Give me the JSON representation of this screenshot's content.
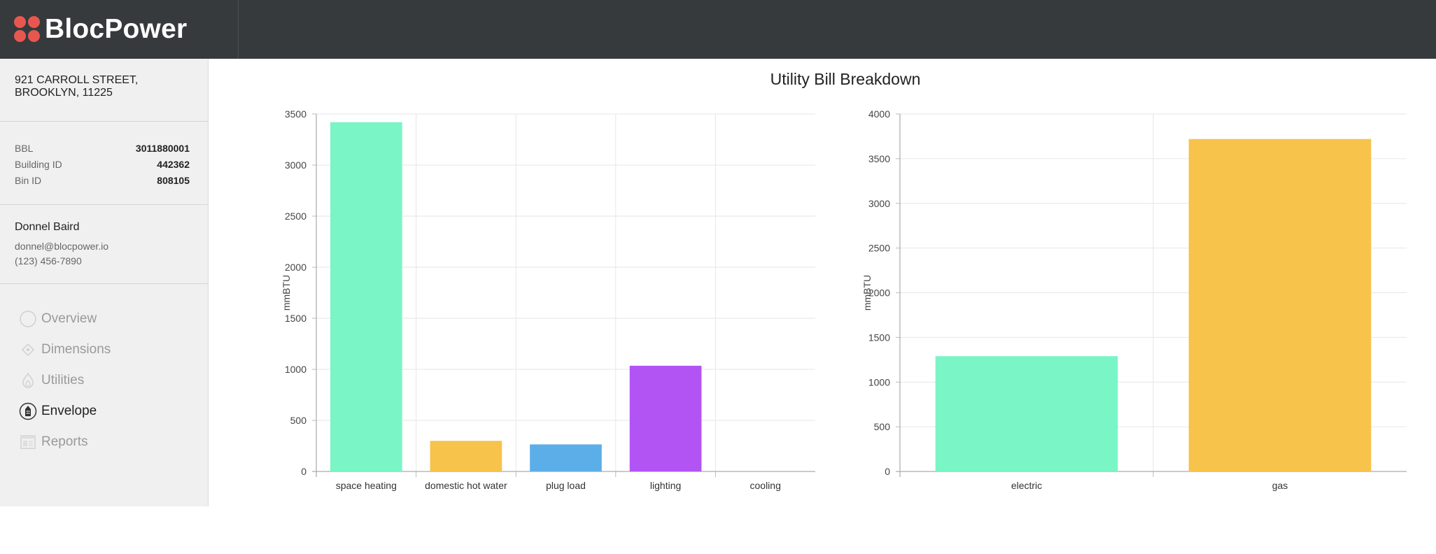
{
  "header": {
    "logo_text": "BlocPower",
    "logo_color": "#e8574f",
    "bar_color": "#363a3d"
  },
  "sidebar": {
    "address_line1": "921 CARROLL STREET,",
    "address_line2": "BROOKLYN, 11225",
    "ids": [
      {
        "label": "BBL",
        "value": "3011880001"
      },
      {
        "label": "Building ID",
        "value": "442362"
      },
      {
        "label": "Bin ID",
        "value": "808105"
      }
    ],
    "contact": {
      "name": "Donnel Baird",
      "email": "donnel@blocpower.io",
      "phone": "(123) 456-7890"
    },
    "nav": [
      {
        "label": "Overview",
        "icon": "circle-icon",
        "active": false
      },
      {
        "label": "Dimensions",
        "icon": "diamond-icon",
        "active": false
      },
      {
        "label": "Utilities",
        "icon": "flame-icon",
        "active": false
      },
      {
        "label": "Envelope",
        "icon": "building-icon",
        "active": true
      },
      {
        "label": "Reports",
        "icon": "report-icon",
        "active": false
      }
    ]
  },
  "main": {
    "title": "Utility Bill Breakdown"
  },
  "chart_data": [
    {
      "type": "bar",
      "categories": [
        "space heating",
        "domestic hot water",
        "plug load",
        "lighting",
        "cooling"
      ],
      "values": [
        3420,
        300,
        265,
        1035,
        0
      ],
      "colors": [
        "#79f5c6",
        "#f7c34b",
        "#5caee8",
        "#b254f4",
        "#cccccc"
      ],
      "ylabel": "mmBTU",
      "xlabel": "",
      "ylim": [
        0,
        3500
      ],
      "yticks": [
        0,
        500,
        1000,
        1500,
        2000,
        2500,
        3000,
        3500
      ],
      "grid": true
    },
    {
      "type": "bar",
      "categories": [
        "electric",
        "gas"
      ],
      "values": [
        1290,
        3720
      ],
      "colors": [
        "#79f5c6",
        "#f7c34b"
      ],
      "ylabel": "mmBTU",
      "xlabel": "",
      "ylim": [
        0,
        4000
      ],
      "yticks": [
        0,
        500,
        1000,
        1500,
        2000,
        2500,
        3000,
        3500,
        4000
      ],
      "grid": true
    }
  ]
}
